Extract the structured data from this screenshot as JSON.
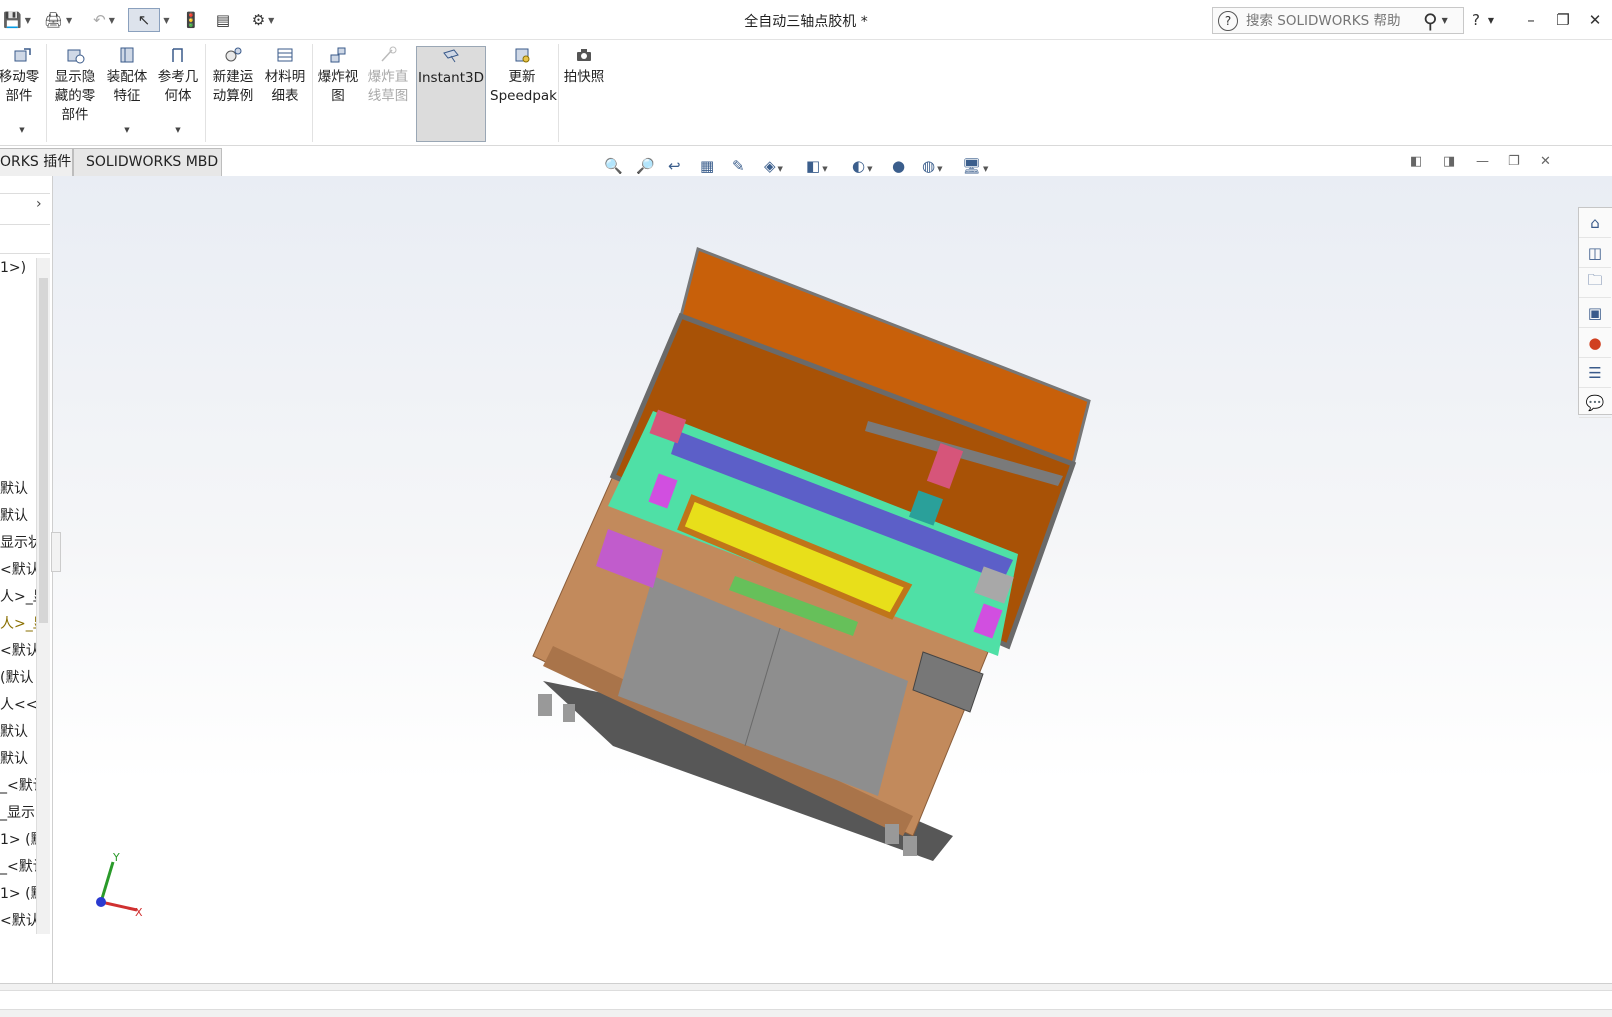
{
  "window": {
    "title": "全自动三轴点胶机 *",
    "search_placeholder": "搜索 SOLIDWORKS 帮助",
    "help_glyph": "?",
    "minimize": "–",
    "restore": "❐",
    "close": "✕"
  },
  "quick_access": {
    "save": "💾",
    "print": "🖨",
    "undo": "↶",
    "select": "↖",
    "rebuild": "🚦",
    "file_props": "▤",
    "options": "⚙"
  },
  "ribbon": {
    "move_component": "移动零\n部件",
    "show_hidden": "显示隐\n藏的零\n部件",
    "assembly_features": "装配体\n特征",
    "reference_geometry": "参考几\n何体",
    "new_motion_study": "新建运\n动算例",
    "bill_of_materials": "材料明\n细表",
    "exploded_view": "爆炸视\n图",
    "explode_line_sketch": "爆炸直\n线草图",
    "instant3d": "Instant3D",
    "update_speedpak": "更新\nSpeedpak",
    "take_snapshot": "拍快照"
  },
  "tabs": [
    "ORKS 插件",
    "SOLIDWORKS MBD"
  ],
  "tree": {
    "rows": [
      "1>)",
      "默认",
      "默认",
      "显示状",
      "<默认",
      "人>_显",
      "人>_显",
      "<默认",
      "(默认",
      "人<<默",
      "默认",
      "默认",
      "_<默认",
      "_显示",
      "1> (默",
      "_<默认",
      "1> (默",
      "<默认"
    ]
  },
  "triad": {
    "x_label": "X",
    "y_label": "Y"
  },
  "colors": {
    "cabinet_lower": "#c28a5c",
    "frame_orange": "#c8600a",
    "inner_orange": "#a85206",
    "table_green": "#4fe0a6",
    "beam_blue": "#5c5fc8",
    "door_gray": "#8e8e8e",
    "yellow_fixture": "#e8df1a",
    "magenta": "#d14fe0"
  }
}
